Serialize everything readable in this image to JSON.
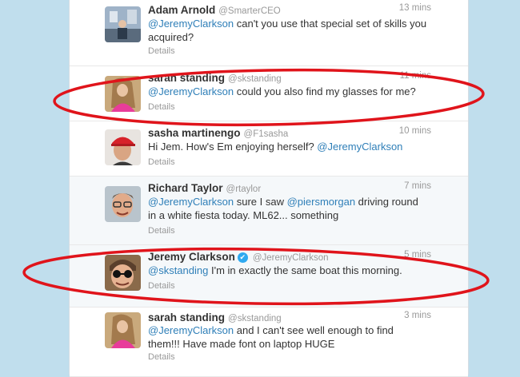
{
  "tweets": [
    {
      "name": "Adam Arnold",
      "handle": "@SmarterCEO",
      "time": "13 mins",
      "mention1": "@JeremyClarkson",
      "text1": " can't you use that special set of skills you acquired?",
      "details": "Details"
    },
    {
      "name": "sarah standing",
      "handle": "@skstanding",
      "time": "11 mins",
      "mention1": "@JeremyClarkson",
      "text1": " could you also find my glasses for me?",
      "details": "Details"
    },
    {
      "name": "sasha martinengo",
      "handle": "@F1sasha",
      "time": "10 mins",
      "text0": "Hi Jem. How's Em enjoying herself? ",
      "mention1": "@JeremyClarkson",
      "details": "Details"
    },
    {
      "name": "Richard Taylor",
      "handle": "@rtaylor",
      "time": "7 mins",
      "mention1": "@JeremyClarkson",
      "text1": " sure I saw ",
      "mention2": "@piersmorgan",
      "text2": " driving round in a white fiesta today. ML62... something",
      "details": "Details"
    },
    {
      "name": "Jeremy Clarkson",
      "handle": "@JeremyClarkson",
      "time": "5 mins",
      "verified": "✔",
      "mention1": "@skstanding",
      "text1": " I'm in exactly the same boat this morning.",
      "details": "Details"
    },
    {
      "name": "sarah standing",
      "handle": "@skstanding",
      "time": "3 mins",
      "mention1": "@JeremyClarkson",
      "text1": " and I can't see well enough to find them!!! Have made font on laptop HUGE",
      "details": "Details"
    }
  ]
}
